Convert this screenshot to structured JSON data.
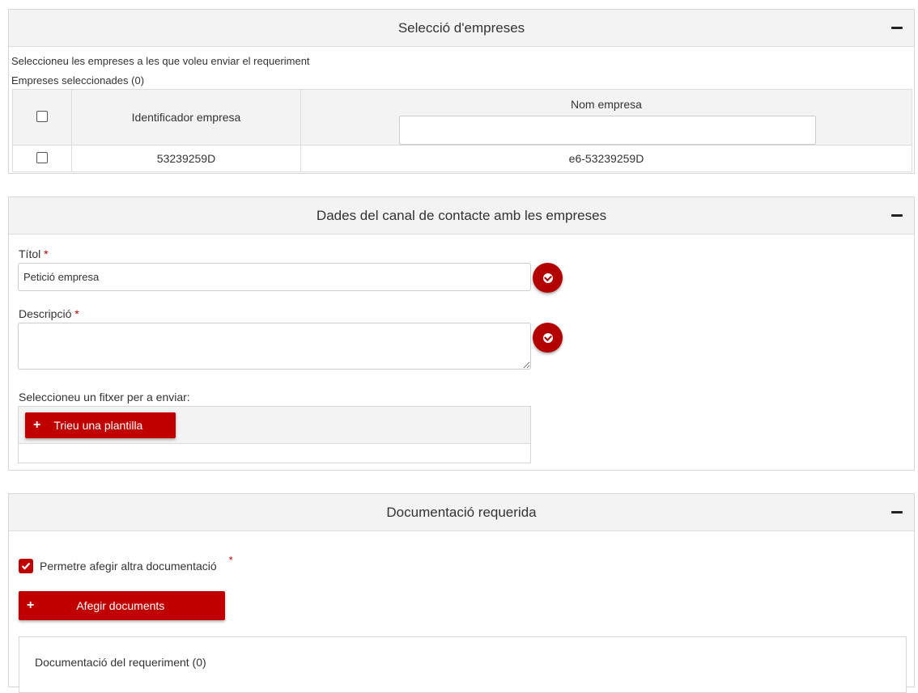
{
  "companies_panel": {
    "title": "Selecció d'empreses",
    "instruction": "Seleccioneu les empreses a les que voleu enviar el requeriment",
    "selected_count_label": "Empreses seleccionades (0)",
    "table": {
      "columns": [
        "Identificador empresa",
        "Nom empresa"
      ],
      "name_filter_value": "",
      "rows": [
        {
          "id": "53239259D",
          "name": "e6-53239259D",
          "checked": false
        }
      ]
    }
  },
  "contact_panel": {
    "title": "Dades del canal de contacte amb les empreses",
    "title_field_label": "Títol",
    "title_field_value": "Petició empresa",
    "description_field_label": "Descripció",
    "description_field_value": "",
    "required_mark": "*",
    "file_label": "Seleccioneu un fitxer per a enviar:",
    "template_button_label": "Trieu una plantilla"
  },
  "docs_panel": {
    "title": "Documentació requerida",
    "allow_other_docs_label": "Permetre afegir altra documentació",
    "allow_other_docs_checked": true,
    "required_mark": "*",
    "add_docs_button_label": "Afegir documents",
    "docs_list_label": "Documentació del requeriment (0)"
  },
  "colors": {
    "accent_red": "#c00000",
    "header_bg": "#f3f3f3",
    "border": "#d6d6d6"
  }
}
